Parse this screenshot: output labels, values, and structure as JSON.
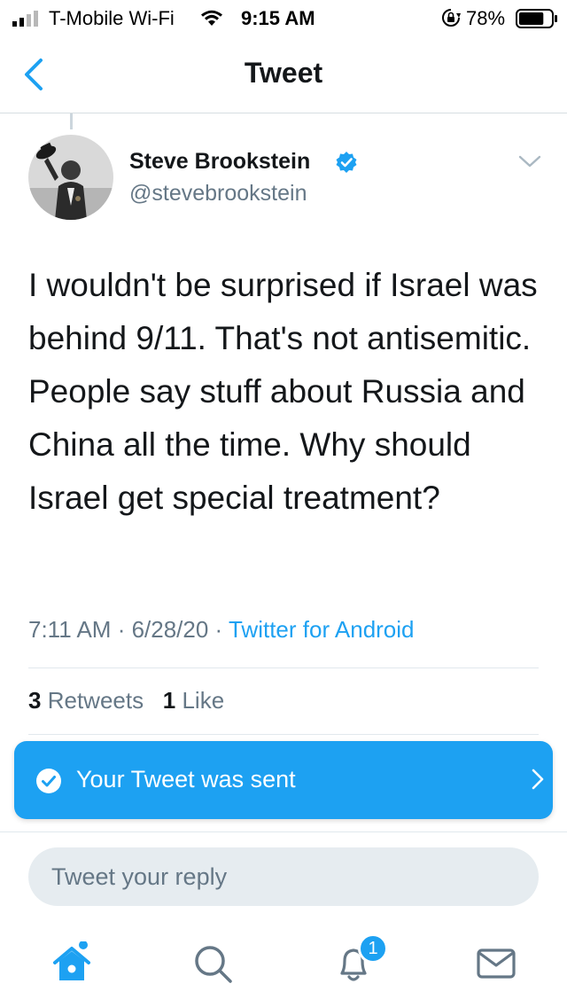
{
  "status_bar": {
    "carrier": "T-Mobile Wi-Fi",
    "time": "9:15 AM",
    "battery_percent": "78%",
    "battery_level": 0.78,
    "signal_bars": 2
  },
  "header": {
    "title": "Tweet"
  },
  "tweet": {
    "author_name": "Steve Brookstein",
    "verified": true,
    "handle": "@stevebrookstein",
    "text": "I wouldn't be surprised if Israel was behind 9/11. That's not antisemitic. People say stuff about Russia and China all the time. Why should Israel get special treatment?",
    "time": "7:11 AM",
    "date": "6/28/20",
    "separator": " · ",
    "source": "Twitter for Android",
    "retweet_count": "3",
    "retweet_label": "Retweets",
    "like_count": "1",
    "like_label": "Like"
  },
  "toast": {
    "message": "Your Tweet was sent"
  },
  "reply": {
    "placeholder": "Tweet your reply"
  },
  "tabbar": {
    "notification_count": "1"
  },
  "colors": {
    "accent": "#1da1f2",
    "text_primary": "#14171a",
    "text_secondary": "#657786",
    "divider": "#e1e8ed",
    "reply_bg": "#e6ecf0"
  },
  "icons": [
    "signal-icon",
    "wifi-icon",
    "rotation-lock-icon",
    "battery-icon",
    "back-chevron-icon",
    "verified-badge-icon",
    "caret-down-icon",
    "check-circle-icon",
    "chevron-right-icon",
    "home-icon",
    "search-icon",
    "notifications-bell-icon",
    "messages-envelope-icon"
  ]
}
